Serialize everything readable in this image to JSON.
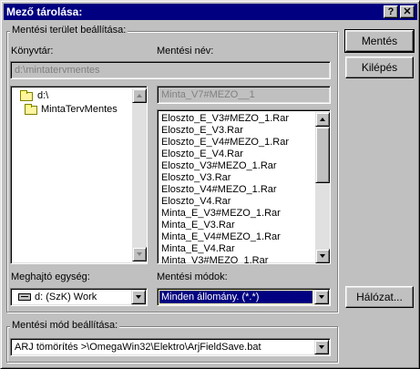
{
  "window": {
    "title": "Mező tárolása:",
    "help_button": "?",
    "close_button": "✕"
  },
  "save_area": {
    "group_title": "Mentési terület beállítása:",
    "directory_label": "Könyvtár:",
    "directory_value": "d:\\mintatervmentes",
    "save_name_label": "Mentési név:",
    "save_name_value": "Minta_V7#MEZO__1",
    "folders": [
      {
        "label": "d:\\",
        "icon": "open-folder-icon"
      },
      {
        "label": "MintaTervMentes",
        "icon": "open-folder-icon"
      }
    ],
    "files": [
      "Eloszto_E_V3#MEZO_1.Rar",
      "Eloszto_E_V3.Rar",
      "Eloszto_E_V4#MEZO_1.Rar",
      "Eloszto_E_V4.Rar",
      "Eloszto_V3#MEZO_1.Rar",
      "Eloszto_V3.Rar",
      "Eloszto_V4#MEZO_1.Rar",
      "Eloszto_V4.Rar",
      "Minta_E_V3#MEZO_1.Rar",
      "Minta_E_V3.Rar",
      "Minta_E_V4#MEZO_1.Rar",
      "Minta_E_V4.Rar",
      "Minta_V3#MEZO_1.Rar"
    ],
    "drive_label": "Meghajtó egység:",
    "drive_value": "d: (SzK) Work",
    "modes_label": "Mentési módok:",
    "modes_value": "Minden állomány. (*.*)"
  },
  "buttons": {
    "save": "Mentés",
    "exit": "Kilépés",
    "network": "Hálózat..."
  },
  "save_mode": {
    "group_title": "Mentési mód beállítása:",
    "value": "ARJ tömörítés >\\OmegaWin32\\Elektro\\ArjFieldSave.bat"
  },
  "colors": {
    "title_bar": "#000080",
    "face": "#c0c0c0",
    "selection": "#000080"
  }
}
